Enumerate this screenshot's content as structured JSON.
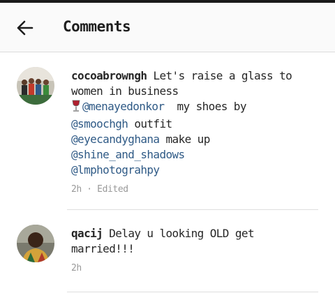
{
  "header": {
    "title": "Comments",
    "back_icon": "arrow-left-icon"
  },
  "colors": {
    "mention": "#2f5a86",
    "meta": "#999999",
    "header_bg": "#fafafa"
  },
  "comments": [
    {
      "username": "cocoabrowngh",
      "text_1": "Let's raise a glass to women in business",
      "emoji_icon": "wine-glass-icon",
      "mention_1": "@menayedonkor",
      "text_2": "  my shoes by",
      "mention_2": "@smoochgh",
      "text_3": " outfit",
      "mention_3": "@eyecandyghana",
      "text_4": " make up",
      "mention_4": "@shine_and_shadows",
      "mention_5": "@lmphotograhpy",
      "time": "2h",
      "separator": " · ",
      "edited": "Edited"
    },
    {
      "username": "qacij",
      "text_1": "Delay u looking OLD get married!!!",
      "time": "2h"
    }
  ]
}
